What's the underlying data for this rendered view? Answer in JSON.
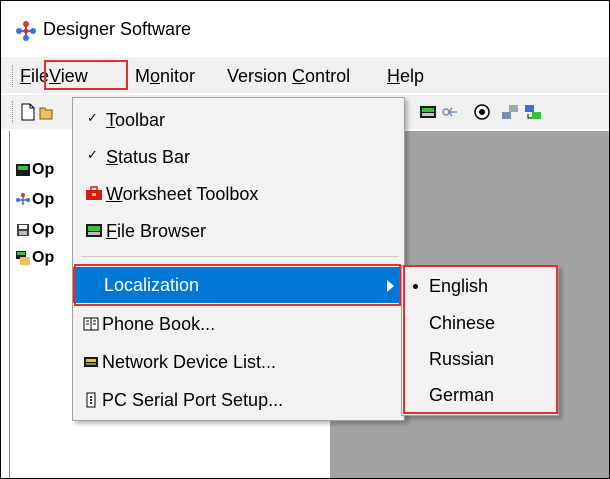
{
  "window": {
    "title": "Designer Software"
  },
  "menubar": {
    "items": [
      {
        "label": "File",
        "mnemonic": "F",
        "rest": "ile"
      },
      {
        "label": "View",
        "mnemonic": "V",
        "rest": "iew"
      },
      {
        "label": "Monitor",
        "pre": "M",
        "mnemonic": "o",
        "rest": "nitor"
      },
      {
        "label": "Version Control",
        "pre": "Version ",
        "mnemonic": "C",
        "rest": "ontrol"
      },
      {
        "label": "Help",
        "mnemonic": "H",
        "rest": "elp"
      }
    ]
  },
  "tree": {
    "items": [
      {
        "label": "Op",
        "icon": "module-icon"
      },
      {
        "label": "Op",
        "icon": "network-icon"
      },
      {
        "label": "Op",
        "icon": "disk-icon"
      },
      {
        "label": "Op",
        "icon": "device-icon"
      }
    ]
  },
  "view_menu": {
    "toolbar": {
      "mnemonic": "T",
      "rest": "oolbar",
      "checked": true
    },
    "status_bar": {
      "mnemonic": "S",
      "rest": "tatus Bar",
      "checked": true
    },
    "worksheet_toolbox": {
      "mnemonic": "W",
      "rest": "orksheet Toolbox"
    },
    "file_browser": {
      "mnemonic": "F",
      "rest": "ile Browser"
    },
    "localization": "Localization",
    "phone_book": "Phone Book...",
    "network_device_list": "Network Device List...",
    "pc_serial_port_setup": "PC Serial Port Setup..."
  },
  "localization_menu": {
    "items": [
      "English",
      "Chinese",
      "Russian",
      "German"
    ],
    "selected": "English"
  },
  "colors": {
    "highlight": "#0078d7",
    "callout": "#e03030",
    "workspace": "#a3a3a3"
  }
}
